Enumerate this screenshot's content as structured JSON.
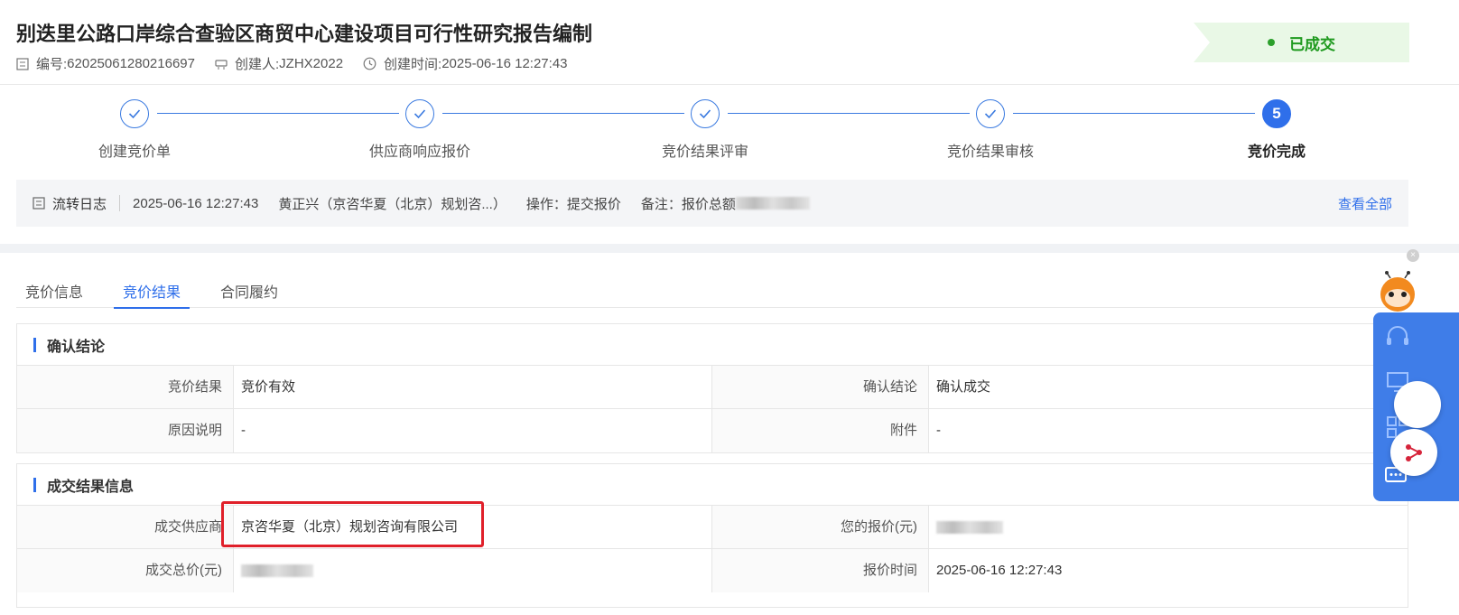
{
  "header": {
    "title": "别迭里公路口岸综合查验区商贸中心建设项目可行性研究报告编制",
    "number_label": "编号:",
    "number": "62025061280216697",
    "creator_label": "创建人:",
    "creator": "JZHX2022",
    "created_label": "创建时间:",
    "created_time": "2025-06-16 12:27:43",
    "status": "已成交",
    "status_color": "#1f9a1f"
  },
  "steps": [
    {
      "label": "创建竞价单",
      "state": "done"
    },
    {
      "label": "供应商响应报价",
      "state": "done"
    },
    {
      "label": "竞价结果评审",
      "state": "done"
    },
    {
      "label": "竞价结果审核",
      "state": "done"
    },
    {
      "label": "竞价完成",
      "state": "active",
      "number": "5"
    }
  ],
  "log": {
    "title": "流转日志",
    "time": "2025-06-16 12:27:43",
    "actor": "黄正兴（京咨华夏（北京）规划咨...）",
    "operation": "操作：提交报价",
    "remark": "备注：报价总额",
    "view_all": "查看全部"
  },
  "tabs": [
    {
      "label": "竞价信息",
      "active": false
    },
    {
      "label": "竞价结果",
      "active": true
    },
    {
      "label": "合同履约",
      "active": false
    }
  ],
  "confirm_section": {
    "title": "确认结论",
    "rows": [
      {
        "l1": "竞价结果",
        "v1": "竞价有效",
        "l2": "确认结论",
        "v2": "确认成交"
      },
      {
        "l1": "原因说明",
        "v1": "-",
        "l2": "附件",
        "v2": "-"
      }
    ]
  },
  "deal_section": {
    "title": "成交结果信息",
    "supplier_label": "成交供应商",
    "supplier": "京咨华夏（北京）规划咨询有限公司",
    "your_price_label": "您的报价(元)",
    "total_label": "成交总价(元)",
    "quote_time_label": "报价时间",
    "quote_time": "2025-06-16 12:27:43"
  },
  "accent_color": "#2f6fea"
}
